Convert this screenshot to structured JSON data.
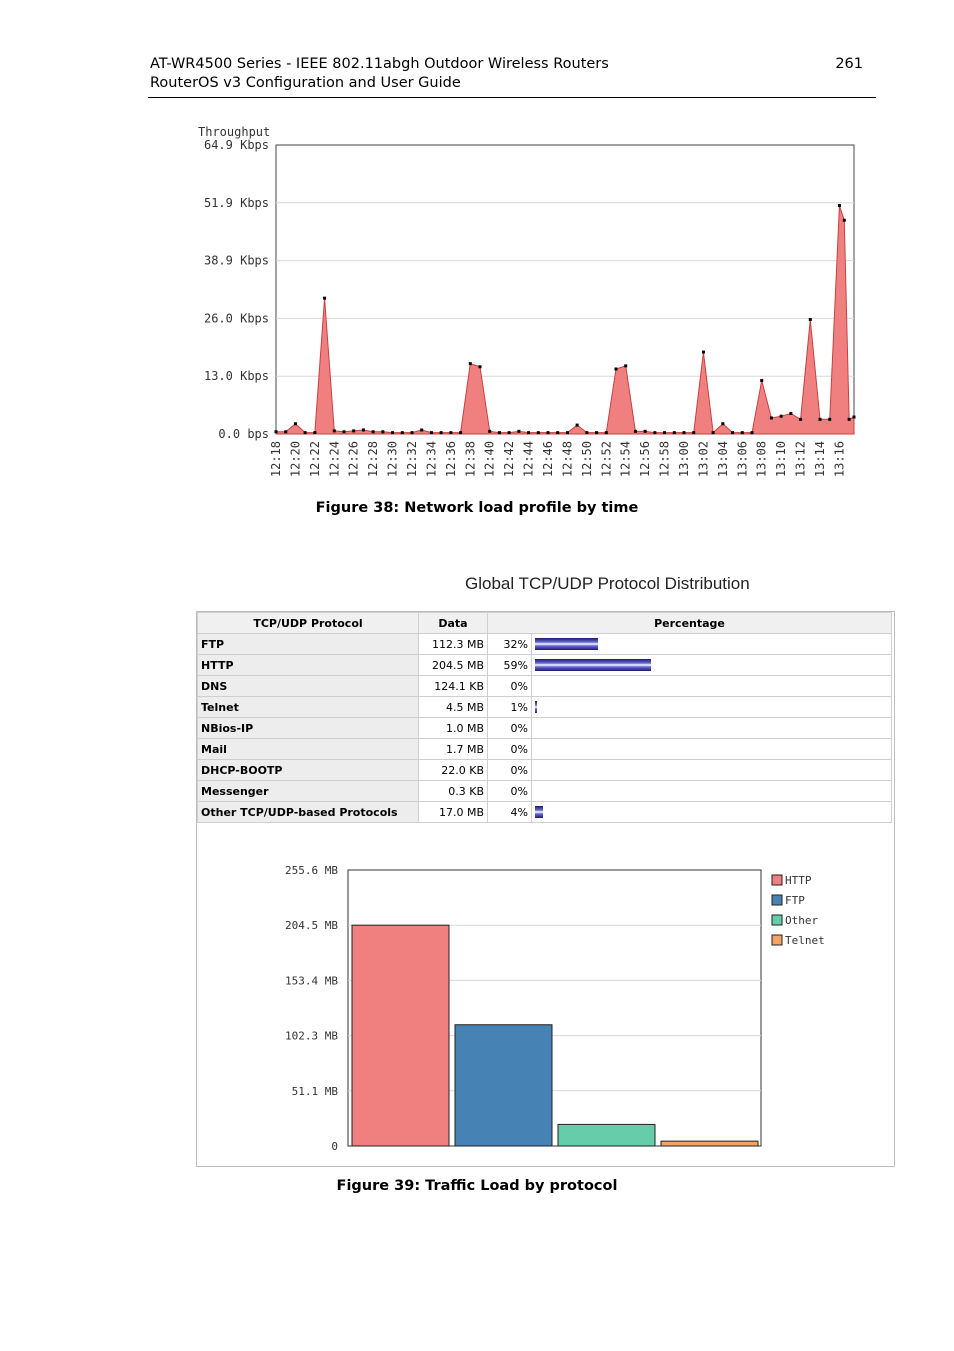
{
  "header": {
    "line1": "AT-WR4500 Series - IEEE 802.11abgh Outdoor Wireless Routers",
    "line2": "RouterOS v3 Configuration and User Guide",
    "page_number": "261"
  },
  "figure38": {
    "caption": "Figure 38: Network load profile by time"
  },
  "figure39": {
    "caption": "Figure 39: Traffic Load by protocol"
  },
  "distribution": {
    "title": "Global TCP/UDP Protocol Distribution",
    "columns": [
      "TCP/UDP Protocol",
      "Data",
      "Percentage"
    ],
    "rows": [
      {
        "protocol": "FTP",
        "data": "112.3 MB",
        "percent": "32%",
        "fraction": 0.32
      },
      {
        "protocol": "HTTP",
        "data": "204.5 MB",
        "percent": "59%",
        "fraction": 0.59
      },
      {
        "protocol": "DNS",
        "data": "124.1 KB",
        "percent": "0%",
        "fraction": 0
      },
      {
        "protocol": "Telnet",
        "data": "4.5 MB",
        "percent": "1%",
        "fraction": 0.01
      },
      {
        "protocol": "NBios-IP",
        "data": "1.0 MB",
        "percent": "0%",
        "fraction": 0
      },
      {
        "protocol": "Mail",
        "data": "1.7 MB",
        "percent": "0%",
        "fraction": 0
      },
      {
        "protocol": "DHCP-BOOTP",
        "data": "22.0 KB",
        "percent": "0%",
        "fraction": 0
      },
      {
        "protocol": "Messenger",
        "data": "0.3 KB",
        "percent": "0%",
        "fraction": 0
      },
      {
        "protocol": "Other TCP/UDP-based Protocols",
        "data": "17.0 MB",
        "percent": "4%",
        "fraction": 0.04
      }
    ]
  },
  "chart_data": [
    {
      "type": "area",
      "title": "",
      "ylabel": "Throughput",
      "xlabel": "",
      "ylim": [
        0,
        64.9
      ],
      "y_ticks": [
        "0.0 bps",
        "13.0 Kbps",
        "26.0 Kbps",
        "38.9 Kbps",
        "51.9 Kbps",
        "64.9 Kbps"
      ],
      "x_ticks": [
        "12:18",
        "12:20",
        "12:22",
        "12:24",
        "12:26",
        "12:28",
        "12:30",
        "12:32",
        "12:34",
        "12:36",
        "12:38",
        "12:40",
        "12:42",
        "12:44",
        "12:46",
        "12:48",
        "12:50",
        "12:52",
        "12:54",
        "12:56",
        "12:58",
        "13:00",
        "13:02",
        "13:04",
        "13:06",
        "13:08",
        "13:10",
        "13:12",
        "13:14",
        "13:16"
      ],
      "color": "#f08080",
      "x_minutes": [
        0,
        1,
        2,
        3,
        4,
        5,
        6,
        7,
        8,
        9,
        10,
        11,
        12,
        13,
        14,
        15,
        16,
        17,
        18,
        19,
        20,
        21,
        22,
        23,
        24,
        25,
        26,
        27,
        28,
        29,
        30,
        31,
        32,
        33,
        34,
        35,
        36,
        37,
        38,
        39,
        40,
        41,
        42,
        43,
        44,
        45,
        46,
        47,
        48,
        49,
        50,
        51,
        52,
        53,
        54,
        55,
        56,
        57,
        58,
        58.5,
        59,
        59.5
      ],
      "values": [
        0.5,
        0.5,
        2.3,
        0.3,
        0.3,
        30.5,
        0.7,
        0.5,
        0.7,
        0.9,
        0.5,
        0.5,
        0.3,
        0.3,
        0.3,
        0.9,
        0.3,
        0.3,
        0.3,
        0.3,
        15.8,
        15.1,
        0.6,
        0.3,
        0.3,
        0.6,
        0.3,
        0.3,
        0.3,
        0.3,
        0.3,
        2.0,
        0.3,
        0.3,
        0.3,
        14.6,
        15.3,
        0.6,
        0.6,
        0.3,
        0.3,
        0.3,
        0.3,
        0.3,
        18.4,
        0.3,
        2.3,
        0.3,
        0.3,
        0.3,
        12.0,
        3.6,
        4.0,
        4.6,
        3.3,
        25.7,
        3.3,
        3.3,
        51.3,
        48.0,
        3.3,
        3.8
      ]
    },
    {
      "type": "bar",
      "title": "",
      "ylim": [
        0,
        255.6
      ],
      "y_ticks": [
        "0",
        "51.1 MB",
        "102.3 MB",
        "153.4 MB",
        "204.5 MB",
        "255.6 MB"
      ],
      "categories": [
        "HTTP",
        "FTP",
        "Other",
        "Telnet"
      ],
      "values": [
        204.5,
        112.3,
        20.0,
        4.5
      ],
      "colors": [
        "#f08080",
        "#4682b4",
        "#66cdaa",
        "#f4a460"
      ],
      "legend": [
        "HTTP",
        "FTP",
        "Other",
        "Telnet"
      ],
      "legend_position": "right"
    }
  ]
}
